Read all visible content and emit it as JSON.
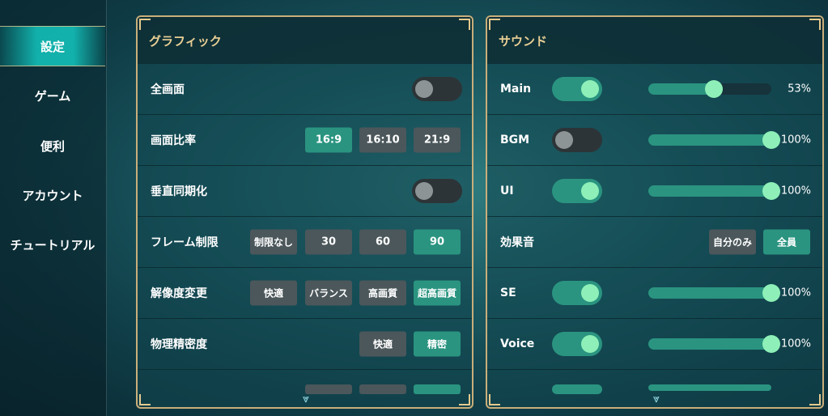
{
  "sidebar": {
    "items": [
      {
        "label": "設定",
        "active": true
      },
      {
        "label": "ゲーム",
        "active": false
      },
      {
        "label": "便利",
        "active": false
      },
      {
        "label": "アカウント",
        "active": false
      },
      {
        "label": "チュートリアル",
        "active": false
      }
    ]
  },
  "graphics": {
    "title": "グラフィック",
    "rows": {
      "fullscreen": {
        "label": "全画面",
        "on": false
      },
      "aspect": {
        "label": "画面比率",
        "options": [
          "16:9",
          "16:10",
          "21:9"
        ],
        "selected": "16:9"
      },
      "vsync": {
        "label": "垂直同期化",
        "on": false
      },
      "framelimit": {
        "label": "フレーム制限",
        "options": [
          "制限なし",
          "30",
          "60",
          "90"
        ],
        "selected": "90"
      },
      "resolution": {
        "label": "解像度変更",
        "options": [
          "快適",
          "バランス",
          "高画質",
          "超高画質"
        ],
        "selected": "超高画質"
      },
      "physics": {
        "label": "物理精密度",
        "options": [
          "快適",
          "精密"
        ],
        "selected": "精密"
      }
    }
  },
  "sound": {
    "title": "サウンド",
    "rows": {
      "main": {
        "label": "Main",
        "on": true,
        "value": 0.53,
        "percent": "53%"
      },
      "bgm": {
        "label": "BGM",
        "on": false,
        "value": 1.0,
        "percent": "100%"
      },
      "ui": {
        "label": "UI",
        "on": true,
        "value": 1.0,
        "percent": "100%"
      },
      "sfx": {
        "label": "効果音",
        "options": [
          "自分のみ",
          "全員"
        ],
        "selected": "全員"
      },
      "se": {
        "label": "SE",
        "on": true,
        "value": 1.0,
        "percent": "100%"
      },
      "voice": {
        "label": "Voice",
        "on": true,
        "value": 1.0,
        "percent": "100%"
      }
    }
  },
  "colors": {
    "accent": "#2a9480",
    "knob_on": "#8ef0b8",
    "header_text": "#e8cf94",
    "frame": "#c9ae7a"
  },
  "icons": {
    "scroll_down": "chevron-double-down-icon"
  }
}
